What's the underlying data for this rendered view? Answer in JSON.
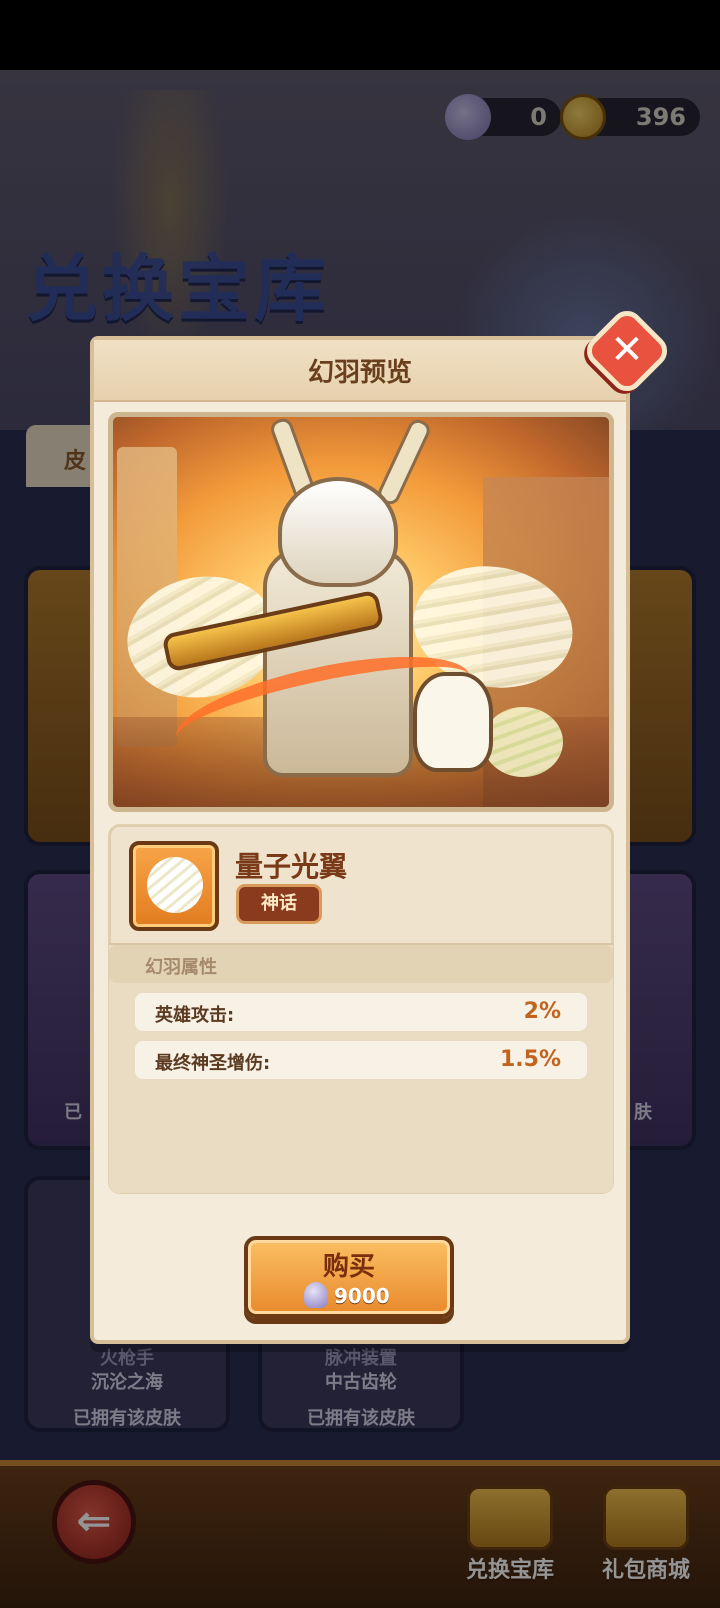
{
  "currency": {
    "jelly": "0",
    "coins": "396"
  },
  "background": {
    "title": "兑换宝库",
    "tab_label": "皮",
    "cards": [
      {
        "line1": "火枪手",
        "line2": "沉沦之海",
        "status": "已拥有该皮肤"
      },
      {
        "line1": "脉冲装置",
        "line2": "中古齿轮",
        "status": "已拥有该皮肤"
      }
    ],
    "side_status_left": "已",
    "side_status_right": "肤"
  },
  "nav": {
    "exchange": "兑换宝库",
    "gift_shop": "礼包商城"
  },
  "modal": {
    "title": "幻羽预览",
    "close": "✕",
    "item": {
      "name": "量子光翼",
      "rarity": "神话"
    },
    "attributes": {
      "title": "幻羽属性",
      "rows": [
        {
          "label": "英雄攻击:",
          "value": "2%"
        },
        {
          "label": "最终神圣增伤:",
          "value": "1.5%"
        }
      ]
    },
    "buy": {
      "label": "购买",
      "price": "9000"
    }
  },
  "colors": {
    "accent": "#e88a2c",
    "close": "#e8523f",
    "rarity": "#8a3b1d"
  }
}
